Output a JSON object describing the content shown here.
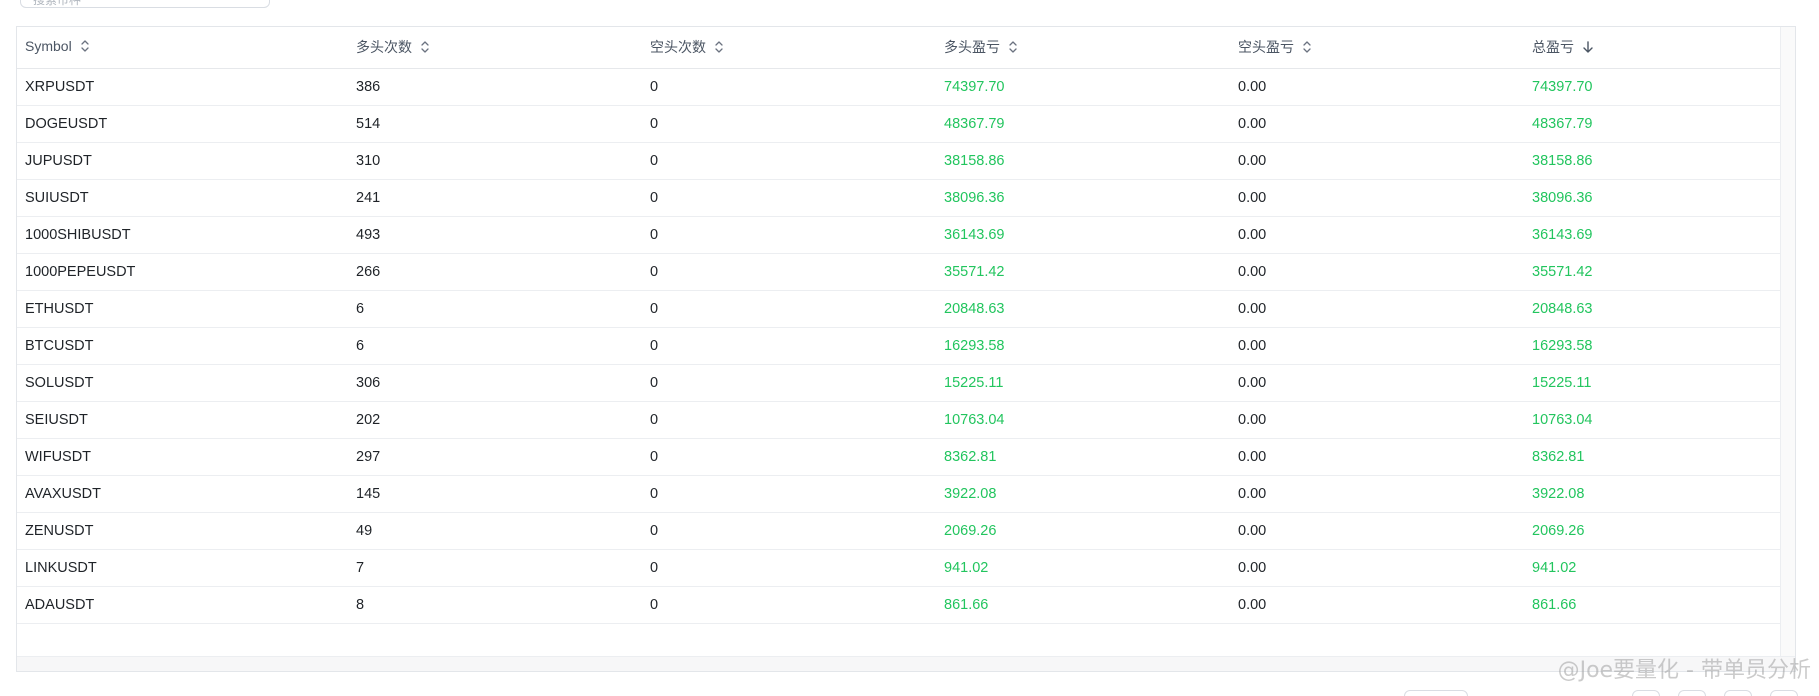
{
  "search": {
    "placeholder": "搜索币种"
  },
  "table": {
    "headers": [
      {
        "label": "Symbol",
        "sort": "none"
      },
      {
        "label": "多头次数",
        "sort": "none"
      },
      {
        "label": "空头次数",
        "sort": "none"
      },
      {
        "label": "多头盈亏",
        "sort": "none"
      },
      {
        "label": "空头盈亏",
        "sort": "none"
      },
      {
        "label": "总盈亏",
        "sort": "desc"
      }
    ],
    "rows": [
      [
        "XRPUSDT",
        "386",
        "0",
        "74397.70",
        "0.00",
        "74397.70"
      ],
      [
        "DOGEUSDT",
        "514",
        "0",
        "48367.79",
        "0.00",
        "48367.79"
      ],
      [
        "JUPUSDT",
        "310",
        "0",
        "38158.86",
        "0.00",
        "38158.86"
      ],
      [
        "SUIUSDT",
        "241",
        "0",
        "38096.36",
        "0.00",
        "38096.36"
      ],
      [
        "1000SHIBUSDT",
        "493",
        "0",
        "36143.69",
        "0.00",
        "36143.69"
      ],
      [
        "1000PEPEUSDT",
        "266",
        "0",
        "35571.42",
        "0.00",
        "35571.42"
      ],
      [
        "ETHUSDT",
        "6",
        "0",
        "20848.63",
        "0.00",
        "20848.63"
      ],
      [
        "BTCUSDT",
        "6",
        "0",
        "16293.58",
        "0.00",
        "16293.58"
      ],
      [
        "SOLUSDT",
        "306",
        "0",
        "15225.11",
        "0.00",
        "15225.11"
      ],
      [
        "SEIUSDT",
        "202",
        "0",
        "10763.04",
        "0.00",
        "10763.04"
      ],
      [
        "WIFUSDT",
        "297",
        "0",
        "8362.81",
        "0.00",
        "8362.81"
      ],
      [
        "AVAXUSDT",
        "145",
        "0",
        "3922.08",
        "0.00",
        "3922.08"
      ],
      [
        "ZENUSDT",
        "49",
        "0",
        "2069.26",
        "0.00",
        "2069.26"
      ],
      [
        "LINKUSDT",
        "7",
        "0",
        "941.02",
        "0.00",
        "941.02"
      ],
      [
        "ADAUSDT",
        "8",
        "0",
        "861.66",
        "0.00",
        "861.66"
      ]
    ]
  },
  "colors": {
    "positive": "#22c55e",
    "header_text": "#4b5563",
    "border": "#e3e6ea"
  },
  "icons": {
    "sort_both": "sort-both-icon",
    "sort_desc": "arrow-down-icon"
  },
  "watermark": "@Joe要量化 - 带单员分析"
}
